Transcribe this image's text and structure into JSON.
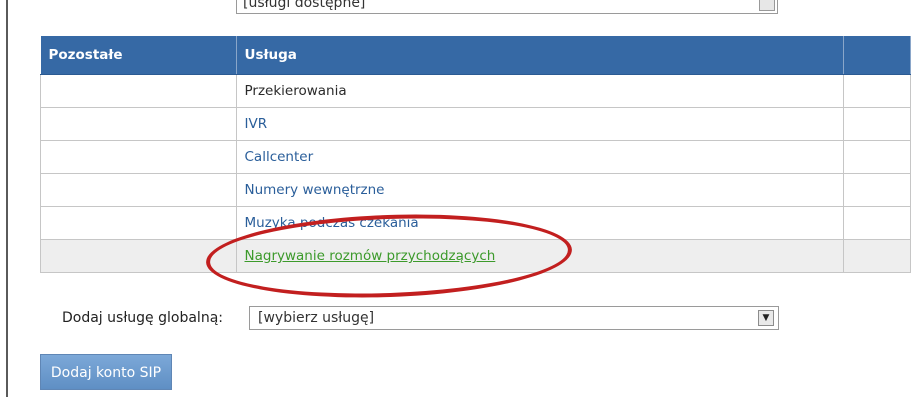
{
  "top_select": {
    "value": "[usługi dostępne]"
  },
  "table": {
    "headers": [
      "Pozostałe",
      "Usługa"
    ],
    "rows": [
      {
        "col1": "",
        "service": "Przekierowania"
      },
      {
        "col1": "",
        "service": "IVR"
      },
      {
        "col1": "",
        "service": "Callcenter"
      },
      {
        "col1": "",
        "service": "Numery wewnętrzne"
      },
      {
        "col1": "",
        "service": "Muzyka podczas czekania"
      },
      {
        "col1": "",
        "service": "Nagrywanie rozmów przychodzących"
      }
    ]
  },
  "global_service": {
    "label": "Dodaj usługę globalną:",
    "select_value": "[wybierz usługę]"
  },
  "add_sip_button": "Dodaj konto SIP",
  "colors": {
    "header_bg": "#3669a5",
    "link": "#2a5e9a",
    "highlight_link": "#3c9a2b",
    "annotation_circle": "#c21f1f"
  }
}
